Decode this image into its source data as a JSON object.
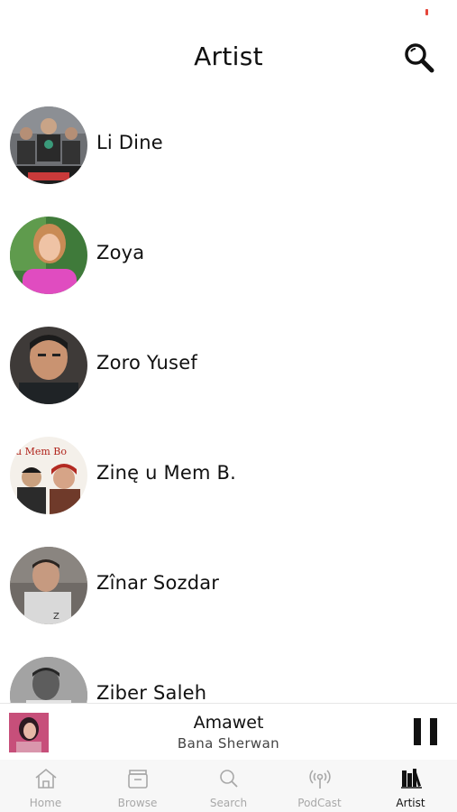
{
  "header": {
    "title": "Artist",
    "search_icon": "search-icon"
  },
  "artists": [
    {
      "name": "Li Dine"
    },
    {
      "name": "Zoya"
    },
    {
      "name": " Zoro Yusef"
    },
    {
      "name": "Zinę u Mem B."
    },
    {
      "name": "Zînar Sozdar"
    },
    {
      "name": "Ziber Saleh"
    }
  ],
  "now_playing": {
    "title": "Amawet",
    "artist": "Bana Sherwan",
    "control_icon": "pause-icon"
  },
  "tabs": [
    {
      "label": "Home",
      "icon": "home-icon",
      "active": false
    },
    {
      "label": "Browse",
      "icon": "browse-icon",
      "active": false
    },
    {
      "label": "Search",
      "icon": "search-icon",
      "active": false
    },
    {
      "label": "PodCast",
      "icon": "podcast-icon",
      "active": false
    },
    {
      "label": "Artist",
      "icon": "artist-icon",
      "active": true
    }
  ],
  "colors": {
    "active_tab": "#111111",
    "inactive_tab": "#a8a8a8",
    "status_indicator": "#e5453a"
  }
}
